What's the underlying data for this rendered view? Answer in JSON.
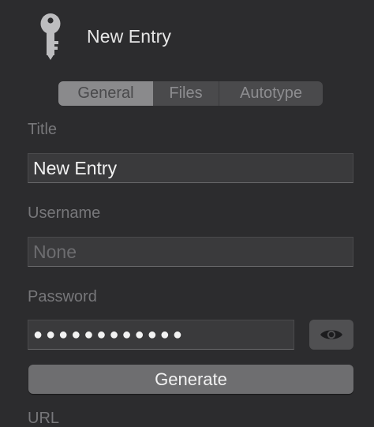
{
  "header": {
    "icon": "key-icon",
    "title": "New Entry"
  },
  "tabs": [
    {
      "label": "General",
      "selected": true
    },
    {
      "label": "Files",
      "selected": false
    },
    {
      "label": "Autotype",
      "selected": false
    }
  ],
  "form": {
    "title_label": "Title",
    "title_value": "New Entry",
    "username_label": "Username",
    "username_placeholder": "None",
    "password_label": "Password",
    "password_masked": "●●●●●●●●●●●●",
    "reveal_icon": "eye-icon",
    "generate_label": "Generate",
    "url_label": "URL"
  },
  "colors": {
    "background": "#2c2c2e",
    "field_bg": "#3a3a3c",
    "selected_tab": "#8a8a8c"
  }
}
